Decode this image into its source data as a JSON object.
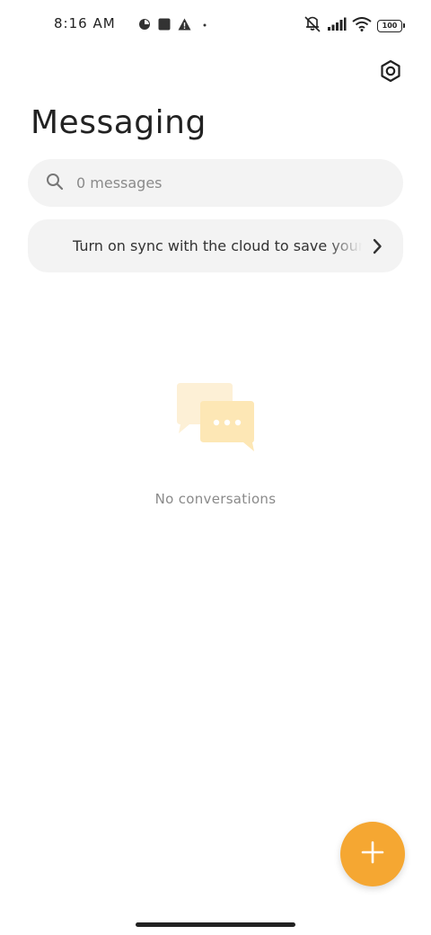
{
  "status_bar": {
    "time": "8:16 AM",
    "battery": "100"
  },
  "header": {
    "title": "Messaging"
  },
  "search": {
    "placeholder": "0 messages"
  },
  "sync_banner": {
    "text": "Turn on sync with the cloud to save your messages"
  },
  "empty_state": {
    "text": "No conversations"
  },
  "colors": {
    "accent": "#f5a732",
    "illustration_back": "#fdf0d6",
    "illustration_front": "#fde7b5",
    "surface": "#f3f3f3"
  },
  "icons": {
    "settings": "settings-icon",
    "search": "search-icon",
    "chevron": "chevron-right-icon",
    "new_message": "plus-icon"
  }
}
